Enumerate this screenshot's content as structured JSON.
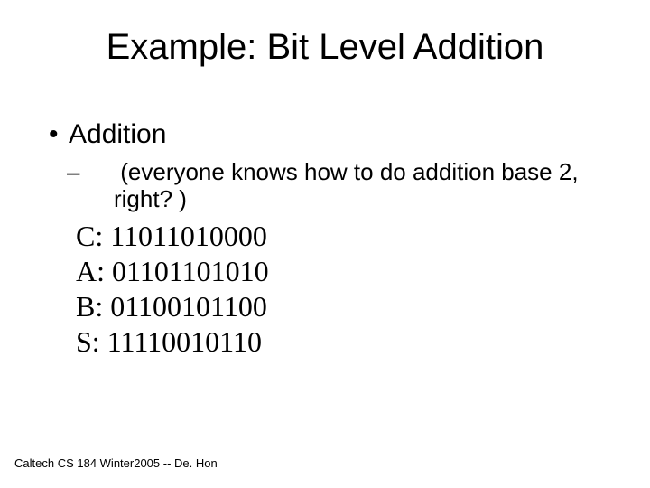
{
  "title": "Example: Bit Level Addition",
  "bullet1": "Addition",
  "bullet2": "(everyone knows how to do addition base 2, right? )",
  "lines": {
    "c": "C: 11011010000",
    "a": "A: 01101101010",
    "b": "B: 01100101100",
    "s": "S: 11110010110"
  },
  "footer": "Caltech CS 184 Winter2005 -- De. Hon"
}
